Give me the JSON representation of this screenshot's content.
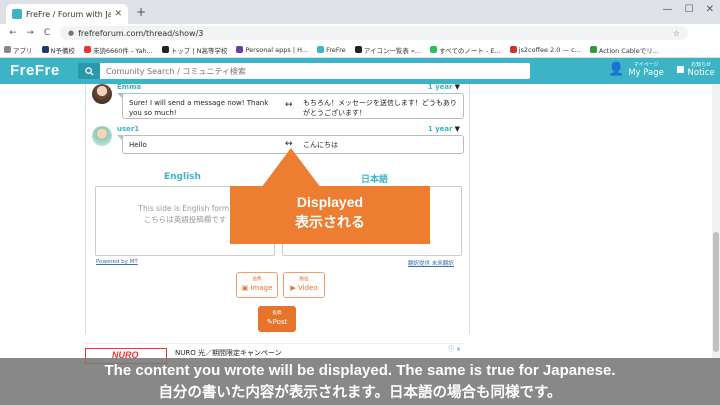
{
  "browser": {
    "tab_title": "FreFre / Forum with Japanese",
    "tab_close": "✕",
    "new_tab": "+",
    "url": "frefreforum.com/thread/show/3",
    "nav_back": "←",
    "nav_forward": "→",
    "nav_reload": "C",
    "win_min": "—",
    "win_max": "☐",
    "win_close": "✕",
    "star": "☆",
    "bookmarks": [
      {
        "label": "アプリ",
        "color": "#888"
      },
      {
        "label": "N予備校",
        "color": "#1a3a6b"
      },
      {
        "label": "未読6660件 - Yah...",
        "color": "#e33"
      },
      {
        "label": "トップ | N高等学校",
        "color": "#222"
      },
      {
        "label": "Personal apps | H...",
        "color": "#6b3fa0"
      },
      {
        "label": "FreFre",
        "color": "#3cb4c6"
      },
      {
        "label": "アイコン一覧表 «...",
        "color": "#222"
      },
      {
        "label": "すべてのノート - E...",
        "color": "#2dbe60"
      },
      {
        "label": "js2coffee 2.0 — c...",
        "color": "#c33"
      },
      {
        "label": "Action Cableでリ...",
        "color": "#2a9d3a"
      }
    ]
  },
  "header": {
    "logo": "FreFre",
    "search_placeholder": "Comunity Search / コミュニティ検索",
    "mypage_small": "マイページ",
    "mypage_label": "My Page",
    "notice_small": "お知らせ",
    "notice_label": "Notice"
  },
  "comments": [
    {
      "user": "Emma",
      "time": "1 year",
      "text_en": "Sure! I will send a message now! Thank you so much!",
      "text_ja": "もちろん！メッセージを送信します！どうもありがとうございます！"
    },
    {
      "user": "user1",
      "time": "1 year",
      "text_en": "Hello",
      "text_ja": "こんにちは"
    }
  ],
  "form": {
    "english_heading": "English",
    "japanese_heading": "日本語",
    "english_placeholder_1": "This side is English form.",
    "english_placeholder_2": "こちらは英語投稿欄です",
    "powered_by": "Powered by MT",
    "translate_link": "翻訳提供 未来翻訳",
    "image_jp": "画像",
    "image_label": "Image",
    "video_jp": "動画",
    "video_label": "Video",
    "post_jp": "投稿",
    "post_label": "Post"
  },
  "callout": {
    "line1": "Displayed",
    "line2": "表示される"
  },
  "ad": {
    "brand": "NURO",
    "title": "NURO 光／期間限定キャンペーン"
  },
  "caption": {
    "line1": "The content you wrote will be displayed. The same is true for Japanese.",
    "line2": "自分の書いた内容が表示されます。日本語の場合も同様です。"
  }
}
